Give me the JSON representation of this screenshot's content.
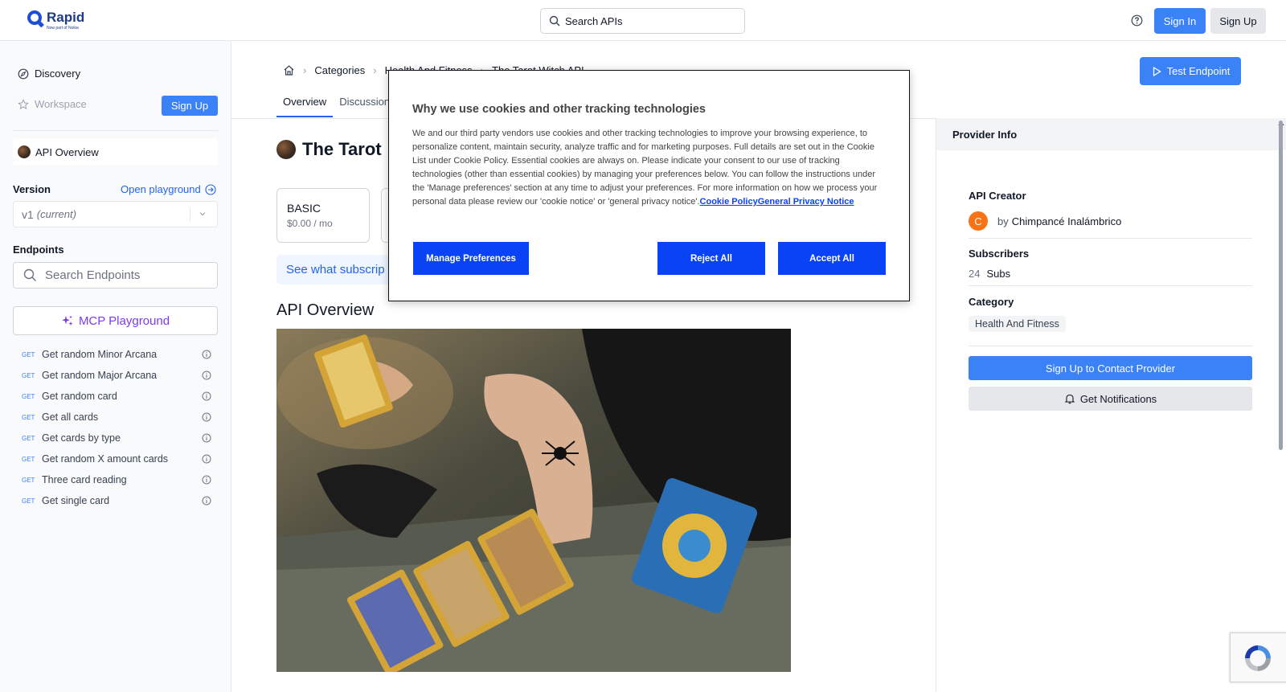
{
  "header": {
    "logo_name": "Rapid",
    "logo_sub": "Now part of Nokia",
    "search_placeholder": "Search APIs",
    "sign_in": "Sign In",
    "sign_up": "Sign Up"
  },
  "sidebar": {
    "discovery": "Discovery",
    "workspace": "Workspace",
    "sign_up": "Sign Up",
    "api_overview": "API Overview",
    "version_label": "Version",
    "open_playground": "Open playground",
    "version_value": "v1",
    "version_current": "(current)",
    "endpoints_label": "Endpoints",
    "endpoints_search_placeholder": "Search Endpoints",
    "mcp_playground": "MCP Playground",
    "endpoints": [
      {
        "method": "GET",
        "name": "Get random Minor Arcana"
      },
      {
        "method": "GET",
        "name": "Get random Major Arcana"
      },
      {
        "method": "GET",
        "name": "Get random card"
      },
      {
        "method": "GET",
        "name": "Get all cards"
      },
      {
        "method": "GET",
        "name": "Get cards by type"
      },
      {
        "method": "GET",
        "name": "Get random X amount cards"
      },
      {
        "method": "GET",
        "name": "Three card reading"
      },
      {
        "method": "GET",
        "name": "Get single card"
      }
    ]
  },
  "main": {
    "breadcrumb": [
      "Categories",
      "Health And Fitness",
      "The Tarot Witch API"
    ],
    "tabs": [
      "Overview",
      "Discussions"
    ],
    "test_endpoint": "Test Endpoint",
    "api_title": "The Tarot",
    "plan": {
      "name": "BASIC",
      "price": "$0.00 / mo"
    },
    "subs_banner": "See what subscrip",
    "overview_heading": "API Overview"
  },
  "provider": {
    "header": "Provider Info",
    "creator_label": "API Creator",
    "creator_initial": "C",
    "creator_by": "by",
    "creator_name": "Chimpancé Inalámbrico",
    "subscribers_label": "Subscribers",
    "subscribers_count": "24",
    "subscribers_unit": "Subs",
    "category_label": "Category",
    "category_value": "Health And Fitness",
    "contact_button": "Sign Up to Contact Provider",
    "notifications_button": "Get Notifications"
  },
  "cookie": {
    "title": "Why we use cookies and other tracking technologies",
    "body": "We and our third party vendors use cookies and other tracking technologies to improve your browsing experience, to personalize content, maintain security, analyze traffic and for marketing purposes. Full details are set out in the Cookie List under Cookie Policy. Essential cookies are always on. Please indicate your consent to our use of tracking technologies (other than essential cookies) by managing your preferences below. You can follow the instructions under the 'Manage preferences' section at any time to adjust your preferences. For more information on how we process your personal data please review our 'cookie notice' or 'general privacy notice'.",
    "link_cookie_policy": "Cookie Policy",
    "link_privacy": "General Privacy Notice",
    "manage": "Manage Preferences",
    "reject": "Reject All",
    "accept": "Accept All"
  }
}
